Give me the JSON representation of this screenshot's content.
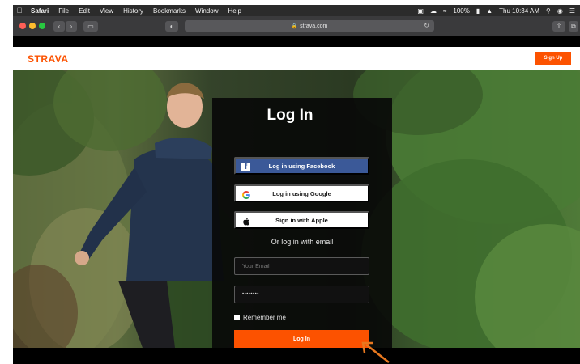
{
  "menubar": {
    "app_name": "Safari",
    "items": [
      "File",
      "Edit",
      "View",
      "History",
      "Bookmarks",
      "Window",
      "Help"
    ],
    "battery": "100%",
    "clock": "Thu 10:34 AM"
  },
  "browser": {
    "url": "strava.com"
  },
  "header": {
    "logo_text": "STRAVA",
    "signup_label": "Sign Up"
  },
  "login": {
    "title": "Log In",
    "facebook_label": "Log in using Facebook",
    "google_label": "Log in using Google",
    "apple_label": "Sign in with Apple",
    "divider_text": "Or log in with email",
    "email_placeholder": "Your Email",
    "password_value": "••••••••",
    "remember_label": "Remember me",
    "submit_label": "Log In"
  },
  "colors": {
    "brand": "#fc5200",
    "facebook": "#3b5998",
    "annotation_arrow": "#e8781f"
  }
}
